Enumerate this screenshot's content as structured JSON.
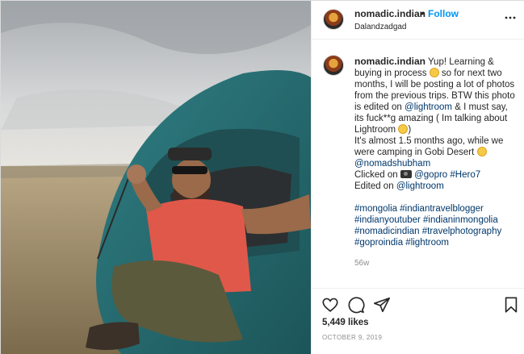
{
  "post": {
    "username": "nomadic.indian",
    "dot": "•",
    "follow_label": "Follow",
    "location": "Dalandzadgad"
  },
  "caption": {
    "username": "nomadic.indian",
    "line1": "Yup! Learning & buying in process",
    "line2": "so for next two months, I will be posting a lot of photos from the previous trips. BTW this photo is edited on",
    "mention_lightroom": "@lightroom",
    "line3": "& I must say, its fuck**g amazing ( Im talking about Lightroom",
    "line3_end": ")",
    "line4": "It's almost 1.5 months ago, while we were camping in Gobi Desert",
    "mention_shubham": "@nomadshubham",
    "clicked_on": "Clicked on",
    "gopro": "@gopro",
    "hero": "#Hero7",
    "edited_on": "Edited on",
    "lightroom2": "@lightroom",
    "hashtags": "#mongolia #indiantravelblogger #indianyoutuber #indianinmongolia #nomadicindian #travelphotography #goproindia #lightroom"
  },
  "time_ago": "56w",
  "likes": "5,449 likes",
  "date": "OCTOBER 9, 2019",
  "icons": {
    "like": "heart-icon",
    "comment": "comment-icon",
    "share": "send-icon",
    "save": "bookmark-icon",
    "more": "more-dots-icon"
  },
  "colors": {
    "follow": "#0095f6",
    "tag": "#00376b",
    "muted": "#8e8e8e"
  }
}
